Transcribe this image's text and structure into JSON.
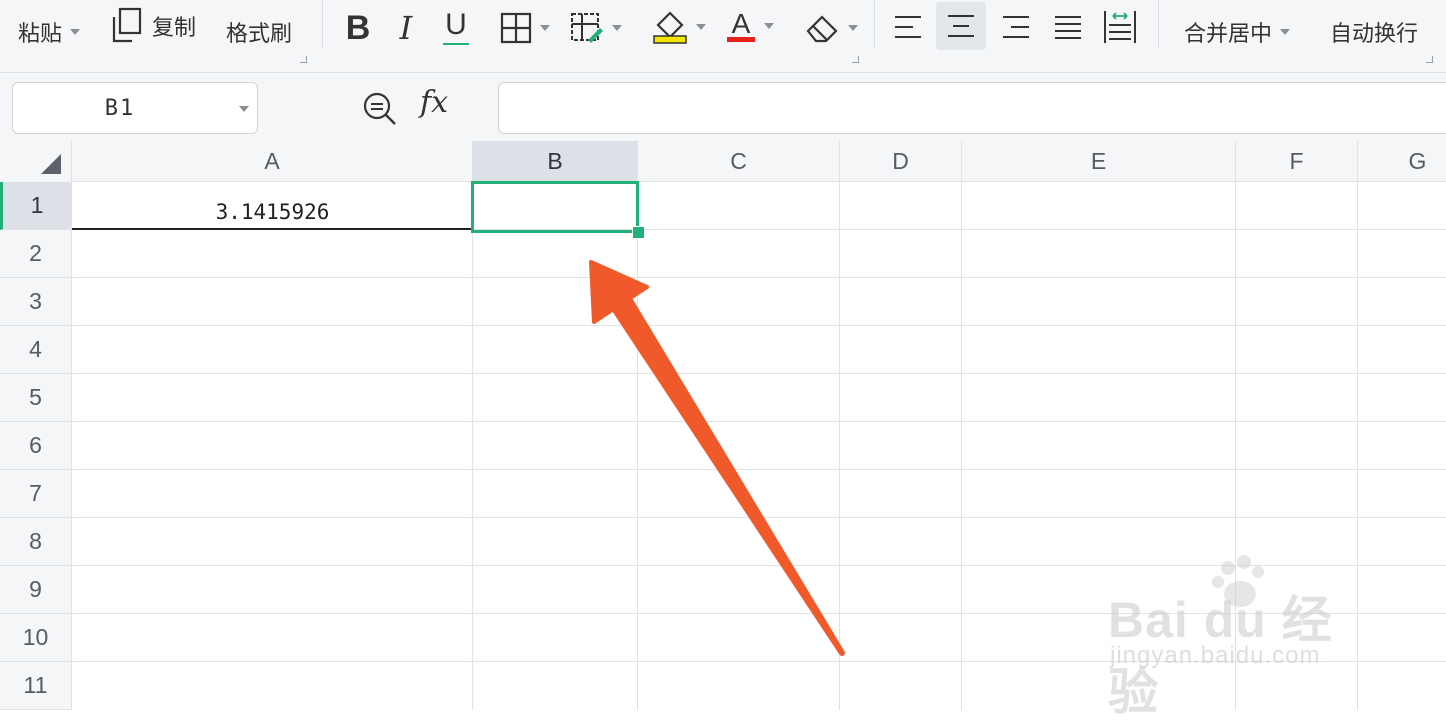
{
  "toolbar": {
    "paste_label": "粘贴",
    "copy_label": "复制",
    "format_painter_label": "格式刷",
    "bold_glyph": "B",
    "italic_glyph": "I",
    "underline_glyph": "U",
    "merge_center_label": "合并居中",
    "wrap_text_label": "自动换行",
    "fill_color": "#f2e600",
    "font_color": "#e8221a",
    "active_tool": "align-center"
  },
  "formula_bar": {
    "namebox_value": "B1",
    "fx_label": "fx",
    "formula_value": ""
  },
  "sheet": {
    "columns": [
      "A",
      "B",
      "C",
      "D",
      "E",
      "F",
      "G"
    ],
    "rows": [
      "1",
      "2",
      "3",
      "4",
      "5",
      "6",
      "7",
      "8",
      "9",
      "10",
      "11"
    ],
    "active_cell": "B1",
    "cells": {
      "A1": "3.1415926"
    },
    "accent_color": "#21b077"
  },
  "annotation": {
    "arrow_color": "#f05a2a"
  },
  "watermark": {
    "main": "Bai du 经验",
    "sub": "jingyan.baidu.com"
  }
}
